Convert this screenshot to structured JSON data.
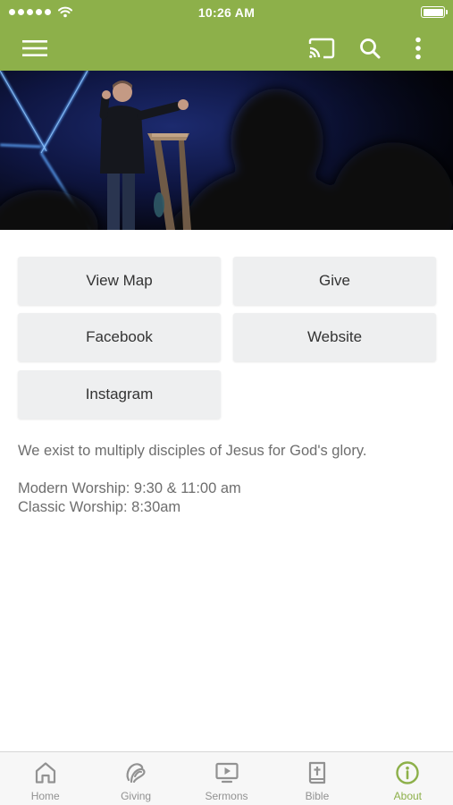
{
  "status_bar": {
    "time": "10:26 AM"
  },
  "header": {
    "icons": [
      "menu-icon",
      "cast-icon",
      "search-icon",
      "more-vertical-icon"
    ],
    "brand_color": "#8db04a"
  },
  "actions": [
    {
      "label": "View Map"
    },
    {
      "label": "Give"
    },
    {
      "label": "Facebook"
    },
    {
      "label": "Website"
    },
    {
      "label": "Instagram"
    }
  ],
  "content": {
    "mission": "We exist to multiply disciples of Jesus for God's glory.",
    "times": [
      "Modern Worship: 9:30 & 11:00 am",
      "Classic Worship: 8:30am"
    ]
  },
  "tabs": [
    {
      "label": "Home",
      "icon": "home-icon"
    },
    {
      "label": "Giving",
      "icon": "giving-icon"
    },
    {
      "label": "Sermons",
      "icon": "sermons-icon"
    },
    {
      "label": "Bible",
      "icon": "bible-icon"
    },
    {
      "label": "About",
      "icon": "info-icon",
      "active": true
    }
  ],
  "colors": {
    "accent": "#8db04a",
    "button_bg": "#eeeff0",
    "tab_inactive": "#929292"
  }
}
